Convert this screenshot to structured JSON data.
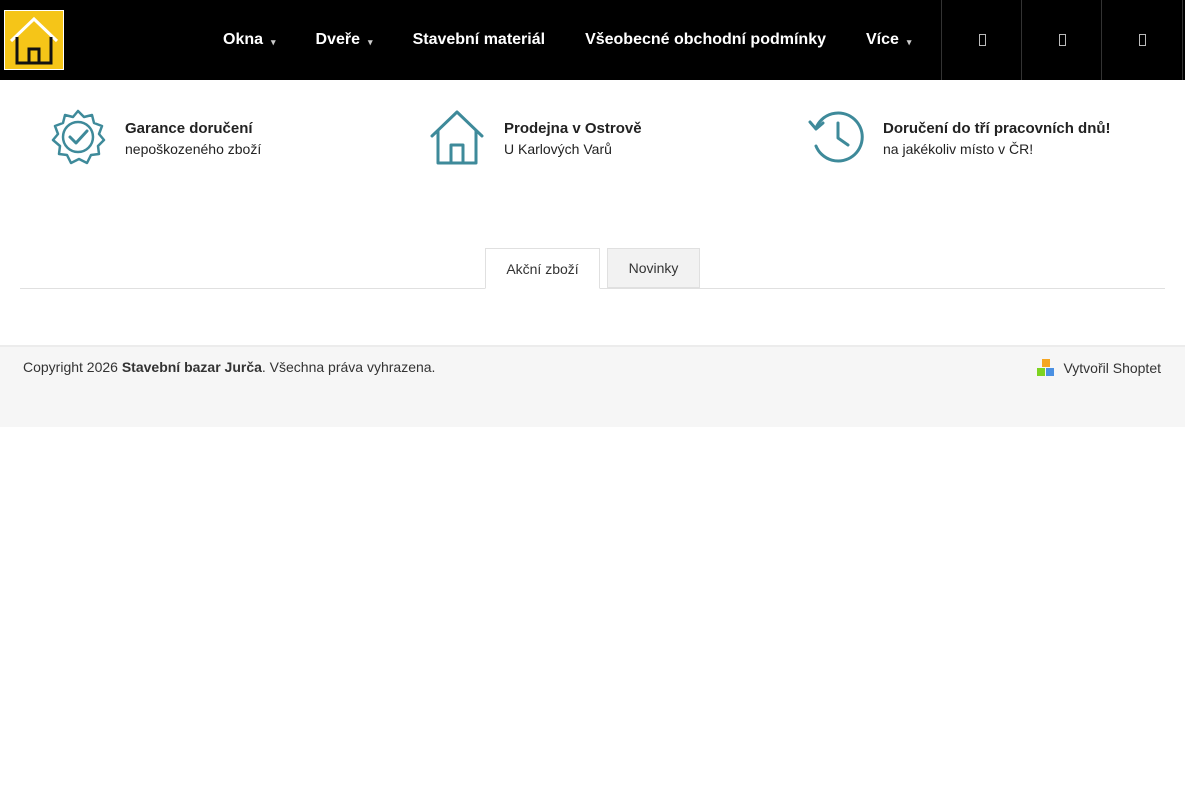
{
  "header": {
    "logo_icon": "house-logo-icon",
    "brand_color": "#f5c518",
    "nav": [
      {
        "label": "Okna",
        "has_dropdown": true
      },
      {
        "label": "Dveře",
        "has_dropdown": true
      },
      {
        "label": "Stavební materiál",
        "has_dropdown": false
      },
      {
        "label": "Všeobecné obchodní podmínky",
        "has_dropdown": false
      },
      {
        "label": "Více",
        "has_dropdown": true
      }
    ],
    "caret": "▾",
    "buttons": [
      "search-icon",
      "user-icon",
      "cart-icon"
    ]
  },
  "benefits": [
    {
      "icon": "badge-check-icon",
      "title": "Garance doručení",
      "subtitle": "nepoškozeného zboží"
    },
    {
      "icon": "home-icon",
      "title": "Prodejna v Ostrově",
      "subtitle": "U Karlových Varů"
    },
    {
      "icon": "history-clock-icon",
      "title": "Doručení do tří pracovních dnů!",
      "subtitle": "na jakékoliv místo v ČR!"
    }
  ],
  "accent_color": "#3e8a9a",
  "tabs": [
    {
      "label": "Akční zboží",
      "active": true
    },
    {
      "label": "Novinky",
      "active": false
    }
  ],
  "footer": {
    "copyright_prefix": "Copyright 2026",
    "company": "Stavební bazar Jurča",
    "copyright_suffix": ". Všechna práva vyhrazena.",
    "credit": "Vytvořil Shoptet"
  }
}
